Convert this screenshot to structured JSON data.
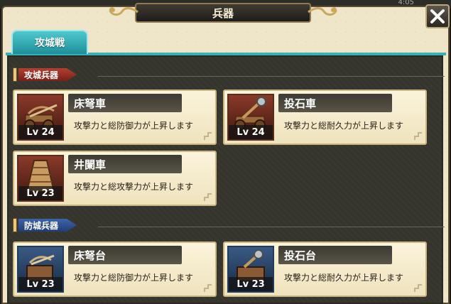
{
  "window": {
    "title": "兵器",
    "clock": "4:05",
    "close_icon": "close-x-icon"
  },
  "tabs": [
    {
      "label": "攻城戦",
      "active": true
    }
  ],
  "sections": {
    "siege": {
      "label": "攻城兵器",
      "color": "#a3362a",
      "items": [
        {
          "name": "床弩車",
          "level": "Lv 24",
          "desc": "攻撃力と総防御力が上昇します",
          "icon": "ballista-cart-icon"
        },
        {
          "name": "投石車",
          "level": "Lv 24",
          "desc": "攻撃力と総耐久力が上昇します",
          "icon": "catapult-cart-icon"
        },
        {
          "name": "井闌車",
          "level": "Lv 23",
          "desc": "攻撃力と総攻撃力が上昇します",
          "icon": "siege-tower-icon"
        }
      ]
    },
    "defense": {
      "label": "防城兵器",
      "color": "#2f4f92",
      "items": [
        {
          "name": "床弩台",
          "level": "Lv 23",
          "desc": "攻撃力と総防御力が上昇します",
          "icon": "ballista-platform-icon"
        },
        {
          "name": "投石台",
          "level": "Lv 23",
          "desc": "攻撃力と総耐久力が上昇します",
          "icon": "catapult-platform-icon"
        }
      ]
    }
  },
  "colors": {
    "tab_accent": "#36b1b8",
    "panel": "#36352d",
    "card": "#f6eccd"
  }
}
